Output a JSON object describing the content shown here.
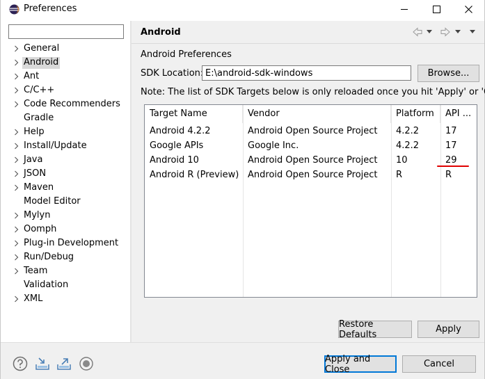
{
  "window": {
    "title": "Preferences",
    "minimize_icon": "minimize-icon",
    "maximize_icon": "maximize-icon",
    "close_icon": "close-icon"
  },
  "sidebar": {
    "filter_value": "",
    "items": [
      {
        "label": "General",
        "expandable": true,
        "selected": false
      },
      {
        "label": "Android",
        "expandable": true,
        "selected": true
      },
      {
        "label": "Ant",
        "expandable": true,
        "selected": false
      },
      {
        "label": "C/C++",
        "expandable": true,
        "selected": false
      },
      {
        "label": "Code Recommenders",
        "expandable": true,
        "selected": false
      },
      {
        "label": "Gradle",
        "expandable": false,
        "selected": false
      },
      {
        "label": "Help",
        "expandable": true,
        "selected": false
      },
      {
        "label": "Install/Update",
        "expandable": true,
        "selected": false
      },
      {
        "label": "Java",
        "expandable": true,
        "selected": false
      },
      {
        "label": "JSON",
        "expandable": true,
        "selected": false
      },
      {
        "label": "Maven",
        "expandable": true,
        "selected": false
      },
      {
        "label": "Model Editor",
        "expandable": false,
        "selected": false
      },
      {
        "label": "Mylyn",
        "expandable": true,
        "selected": false
      },
      {
        "label": "Oomph",
        "expandable": true,
        "selected": false
      },
      {
        "label": "Plug-in Development",
        "expandable": true,
        "selected": false
      },
      {
        "label": "Run/Debug",
        "expandable": true,
        "selected": false
      },
      {
        "label": "Team",
        "expandable": true,
        "selected": false
      },
      {
        "label": "Validation",
        "expandable": false,
        "selected": false
      },
      {
        "label": "XML",
        "expandable": true,
        "selected": false
      }
    ]
  },
  "page": {
    "title": "Android",
    "section_label": "Android Preferences",
    "sdk_location_label": "SDK Location:",
    "sdk_location_value": "E:\\android-sdk-windows",
    "browse_label": "Browse...",
    "note": "Note: The list of SDK Targets below is only reloaded once you hit 'Apply' or 'OK'.",
    "table": {
      "headers": [
        "Target Name",
        "Vendor",
        "Platform",
        "API ..."
      ],
      "rows": [
        [
          "Android 4.2.2",
          "Android Open Source Project",
          "4.2.2",
          "17"
        ],
        [
          "Google APIs",
          "Google Inc.",
          "4.2.2",
          "17"
        ],
        [
          "Android 10",
          "Android Open Source Project",
          "10",
          "29"
        ],
        [
          "Android R (Preview)",
          "Android Open Source Project",
          "R",
          "R"
        ]
      ]
    },
    "restore_defaults_label": "Restore Defaults",
    "apply_label": "Apply"
  },
  "footer": {
    "apply_close_label": "Apply and Close",
    "cancel_label": "Cancel",
    "icons": [
      "help-icon",
      "import-icon",
      "export-icon",
      "record-icon"
    ]
  },
  "colors": {
    "accent": "#0078d7",
    "selection": "#d9d9d9",
    "annotation": "#e00000"
  }
}
